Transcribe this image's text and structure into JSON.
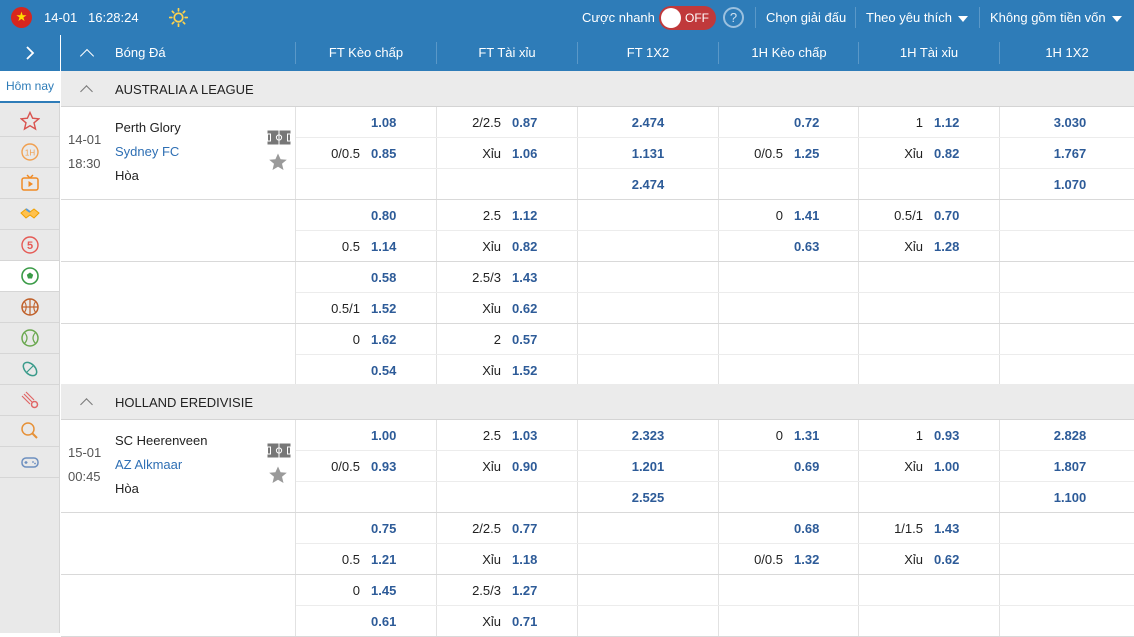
{
  "topbar": {
    "flag_icon": "vietnam-flag-icon",
    "date": "14-01",
    "time": "16:28:24",
    "quick_bet_label": "Cược nhanh",
    "toggle_state": "OFF",
    "choose_league": "Chọn giải đấu",
    "sort_label": "Theo yêu thích",
    "capital_label": "Không gồm tiền vốn"
  },
  "sidebar": {
    "today_label": "Hôm nay",
    "icons": [
      "star-icon",
      "first-half-icon",
      "live-tv-icon",
      "handshake-icon",
      "five-icon",
      "soccer-ball-icon",
      "basketball-icon",
      "tennis-icon",
      "rugby-icon",
      "badminton-icon",
      "table-tennis-icon",
      "gamepad-icon"
    ]
  },
  "header": {
    "sport": "Bóng Đá",
    "cols": [
      "FT Kèo chấp",
      "FT Tài xỉu",
      "FT 1X2",
      "1H Kèo chấp",
      "1H Tài xỉu",
      "1H 1X2"
    ]
  },
  "leagues": [
    {
      "name": "AUSTRALIA A LEAGUE",
      "match": {
        "date": "14-01",
        "time": "18:30",
        "home": "Perth Glory",
        "away": "Sydney FC",
        "draw": "Hòa"
      },
      "rows": [
        [
          [
            "",
            "1.08"
          ],
          [
            "2/2.5",
            "0.87"
          ],
          [
            "",
            "2.474"
          ],
          [
            "",
            "0.72"
          ],
          [
            "1",
            "1.12"
          ],
          [
            "",
            "3.030"
          ]
        ],
        [
          [
            "0/0.5",
            "0.85"
          ],
          [
            "Xỉu",
            "1.06"
          ],
          [
            "",
            "1.131"
          ],
          [
            "0/0.5",
            "1.25"
          ],
          [
            "Xỉu",
            "0.82"
          ],
          [
            "",
            "1.767"
          ]
        ],
        [
          [
            "",
            ""
          ],
          [
            "",
            ""
          ],
          [
            "",
            "2.474"
          ],
          [
            "",
            ""
          ],
          [
            "",
            ""
          ],
          [
            "",
            "1.070"
          ]
        ],
        [
          [
            "",
            "0.80"
          ],
          [
            "2.5",
            "1.12"
          ],
          [
            "",
            ""
          ],
          [
            "0",
            "1.41"
          ],
          [
            "0.5/1",
            "0.70"
          ],
          [
            "",
            ""
          ]
        ],
        [
          [
            "0.5",
            "1.14"
          ],
          [
            "Xỉu",
            "0.82"
          ],
          [
            "",
            ""
          ],
          [
            "",
            "0.63"
          ],
          [
            "Xỉu",
            "1.28"
          ],
          [
            "",
            ""
          ]
        ],
        [
          [
            "",
            "0.58"
          ],
          [
            "2.5/3",
            "1.43"
          ],
          [
            "",
            ""
          ],
          [
            "",
            ""
          ],
          [
            "",
            ""
          ],
          [
            "",
            ""
          ]
        ],
        [
          [
            "0.5/1",
            "1.52"
          ],
          [
            "Xỉu",
            "0.62"
          ],
          [
            "",
            ""
          ],
          [
            "",
            ""
          ],
          [
            "",
            ""
          ],
          [
            "",
            ""
          ]
        ],
        [
          [
            "0",
            "1.62"
          ],
          [
            "2",
            "0.57"
          ],
          [
            "",
            ""
          ],
          [
            "",
            ""
          ],
          [
            "",
            ""
          ],
          [
            "",
            ""
          ]
        ],
        [
          [
            "",
            "0.54"
          ],
          [
            "Xỉu",
            "1.52"
          ],
          [
            "",
            ""
          ],
          [
            "",
            ""
          ],
          [
            "",
            ""
          ],
          [
            "",
            ""
          ]
        ]
      ]
    },
    {
      "name": "HOLLAND EREDIVISIE",
      "match": {
        "date": "15-01",
        "time": "00:45",
        "home": "SC Heerenveen",
        "away": "AZ Alkmaar",
        "draw": "Hòa"
      },
      "rows": [
        [
          [
            "",
            "1.00"
          ],
          [
            "2.5",
            "1.03"
          ],
          [
            "",
            "2.323"
          ],
          [
            "0",
            "1.31"
          ],
          [
            "1",
            "0.93"
          ],
          [
            "",
            "2.828"
          ]
        ],
        [
          [
            "0/0.5",
            "0.93"
          ],
          [
            "Xỉu",
            "0.90"
          ],
          [
            "",
            "1.201"
          ],
          [
            "",
            "0.69"
          ],
          [
            "Xỉu",
            "1.00"
          ],
          [
            "",
            "1.807"
          ]
        ],
        [
          [
            "",
            ""
          ],
          [
            "",
            ""
          ],
          [
            "",
            "2.525"
          ],
          [
            "",
            ""
          ],
          [
            "",
            ""
          ],
          [
            "",
            "1.100"
          ]
        ],
        [
          [
            "",
            "0.75"
          ],
          [
            "2/2.5",
            "0.77"
          ],
          [
            "",
            ""
          ],
          [
            "",
            "0.68"
          ],
          [
            "1/1.5",
            "1.43"
          ],
          [
            "",
            ""
          ]
        ],
        [
          [
            "0.5",
            "1.21"
          ],
          [
            "Xỉu",
            "1.18"
          ],
          [
            "",
            ""
          ],
          [
            "0/0.5",
            "1.32"
          ],
          [
            "Xỉu",
            "0.62"
          ],
          [
            "",
            ""
          ]
        ],
        [
          [
            "0",
            "1.45"
          ],
          [
            "2.5/3",
            "1.27"
          ],
          [
            "",
            ""
          ],
          [
            "",
            ""
          ],
          [
            "",
            ""
          ],
          [
            "",
            ""
          ]
        ],
        [
          [
            "",
            "0.61"
          ],
          [
            "Xỉu",
            "0.71"
          ],
          [
            "",
            ""
          ],
          [
            "",
            ""
          ],
          [
            "",
            ""
          ],
          [
            "",
            ""
          ]
        ]
      ]
    }
  ]
}
